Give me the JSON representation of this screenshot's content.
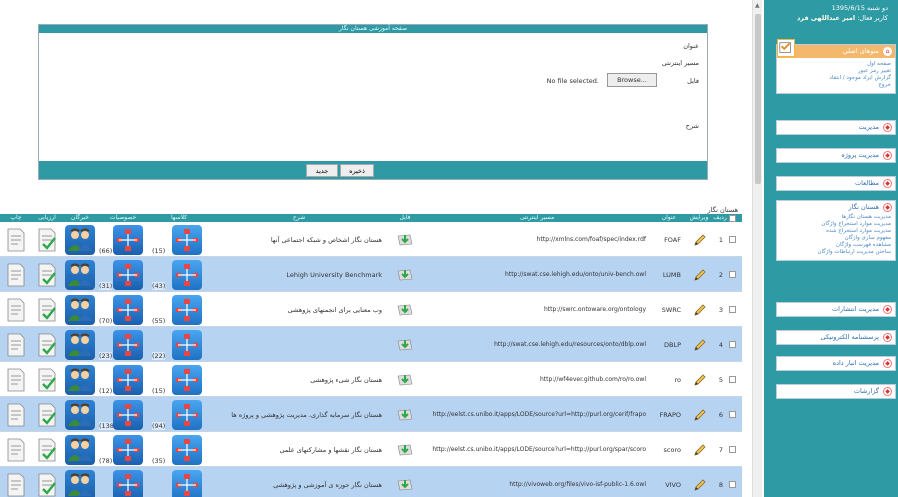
{
  "form": {
    "header": "صفحه آموزشی هستان نگار",
    "title_label": "عنوان",
    "url_label": "مسیر اینترنتی",
    "file_label": "فایل",
    "desc_label": "شرح",
    "file_status": "No file selected.",
    "browse_label": "Browse...",
    "save_label": "ذخیره",
    "new_label": "جدید"
  },
  "table": {
    "title": "هستان نگار",
    "headers": {
      "row": "ردیف",
      "edit": "ویرایش",
      "abbr": "عنوان",
      "url": "مسیر اینترنتی",
      "file": "فایل",
      "desc": "شرح",
      "classes": "کلاسها",
      "props": "خصوصیات",
      "experts": "خبرگان",
      "insert": "ارزیابی",
      "print": "چاپ"
    },
    "rows": [
      {
        "num": "1",
        "abbr": "FOAF",
        "url": "http://xmlns.com/foaf/spec/index.rdf",
        "desc": "هستان نگار اشخاص و شبکه اجتماعی آنها",
        "classes": "(15)",
        "props": "(66)"
      },
      {
        "num": "2",
        "abbr": "LUMB",
        "url": "http://swat.cse.lehigh.edu/onto/univ-bench.owl",
        "desc": "Lehigh University Benchmark",
        "classes": "(43)",
        "props": "(31)"
      },
      {
        "num": "3",
        "abbr": "SWRC",
        "url": "http://swrc.ontoware.org/ontology",
        "desc": "وب معنایی برای انجمنهای پژوهشی",
        "classes": "(55)",
        "props": "(70)"
      },
      {
        "num": "4",
        "abbr": "DBLP",
        "url": "http://swat.cse.lehigh.edu/resources/onto/dblp.owl",
        "desc": "",
        "classes": "(22)",
        "props": "(23)"
      },
      {
        "num": "5",
        "abbr": "ro",
        "url": "http://wf4ever.github.com/ro/ro.owl",
        "desc": "هستان نگار شیء پژوهشی",
        "classes": "(15)",
        "props": "(12)"
      },
      {
        "num": "6",
        "abbr": "FRAPO",
        "url": "http://eelst.cs.unibo.it/apps/LODE/source?url=http://purl.org/cerif/frapo",
        "desc": "هستان نگار سرمایه گذاری، مدیریت پژوهشی و پروژه ها",
        "classes": "(94)",
        "props": "(138)"
      },
      {
        "num": "7",
        "abbr": "scoro",
        "url": "http://eelst.cs.unibo.it/apps/LODE/source?url=http://purl.org/spar/scoro",
        "desc": "هستان نگار نقشها و مشارکتهای علمی",
        "classes": "(35)",
        "props": "(78)"
      },
      {
        "num": "8",
        "abbr": "VIVO",
        "url": "http://vivoweb.org/files/vivo-isf-public-1.6.owl",
        "desc": "هستان نگار حوزه ی آموزشی و پژوهشی",
        "classes": "",
        "props": ""
      }
    ]
  },
  "sidebar": {
    "date": "دو شنبه 1395/6/15",
    "user_prefix": "کاربر فعال:",
    "user_name": "امیر عبداللهی فرد",
    "home": {
      "title": "منوهای اصلی",
      "items": [
        "صفحه اول",
        "تغییر رمز عبور",
        "گزارش ایراد موجود / انتقاد",
        "خروج"
      ]
    },
    "menus": [
      {
        "label": "مدیریت"
      },
      {
        "label": "مدیریت پروژه"
      },
      {
        "label": "مطالعات"
      }
    ],
    "ontology": {
      "title": "هستان نگار",
      "items": [
        "مدیریت هستان نگارها",
        "مدیریت موارد استخراج واژگان",
        "مدیریت موارد استخراج شده",
        "مفهوم سازی واژگان",
        "مشاهده فهرست واژگان",
        "ساختن مدیریت ارتباطات واژگان"
      ]
    },
    "menus2": [
      {
        "label": "مدیریت انتشارات"
      },
      {
        "label": "پرسشنامه الکترونیکی"
      },
      {
        "label": "مدیریت انبار داده"
      },
      {
        "label": "گزارشات"
      }
    ]
  },
  "colors": {
    "accent": "#2e9aa4",
    "row_alt": "#b7d3f2",
    "badge": "#f07878"
  },
  "icons": {
    "edit": "pencil-icon",
    "file": "download-file-icon",
    "classes": "class-tree-icon",
    "properties": "property-tree-icon",
    "experts": "experts-people-icon",
    "insert": "evaluate-doc-icon",
    "print": "print-doc-icon"
  }
}
